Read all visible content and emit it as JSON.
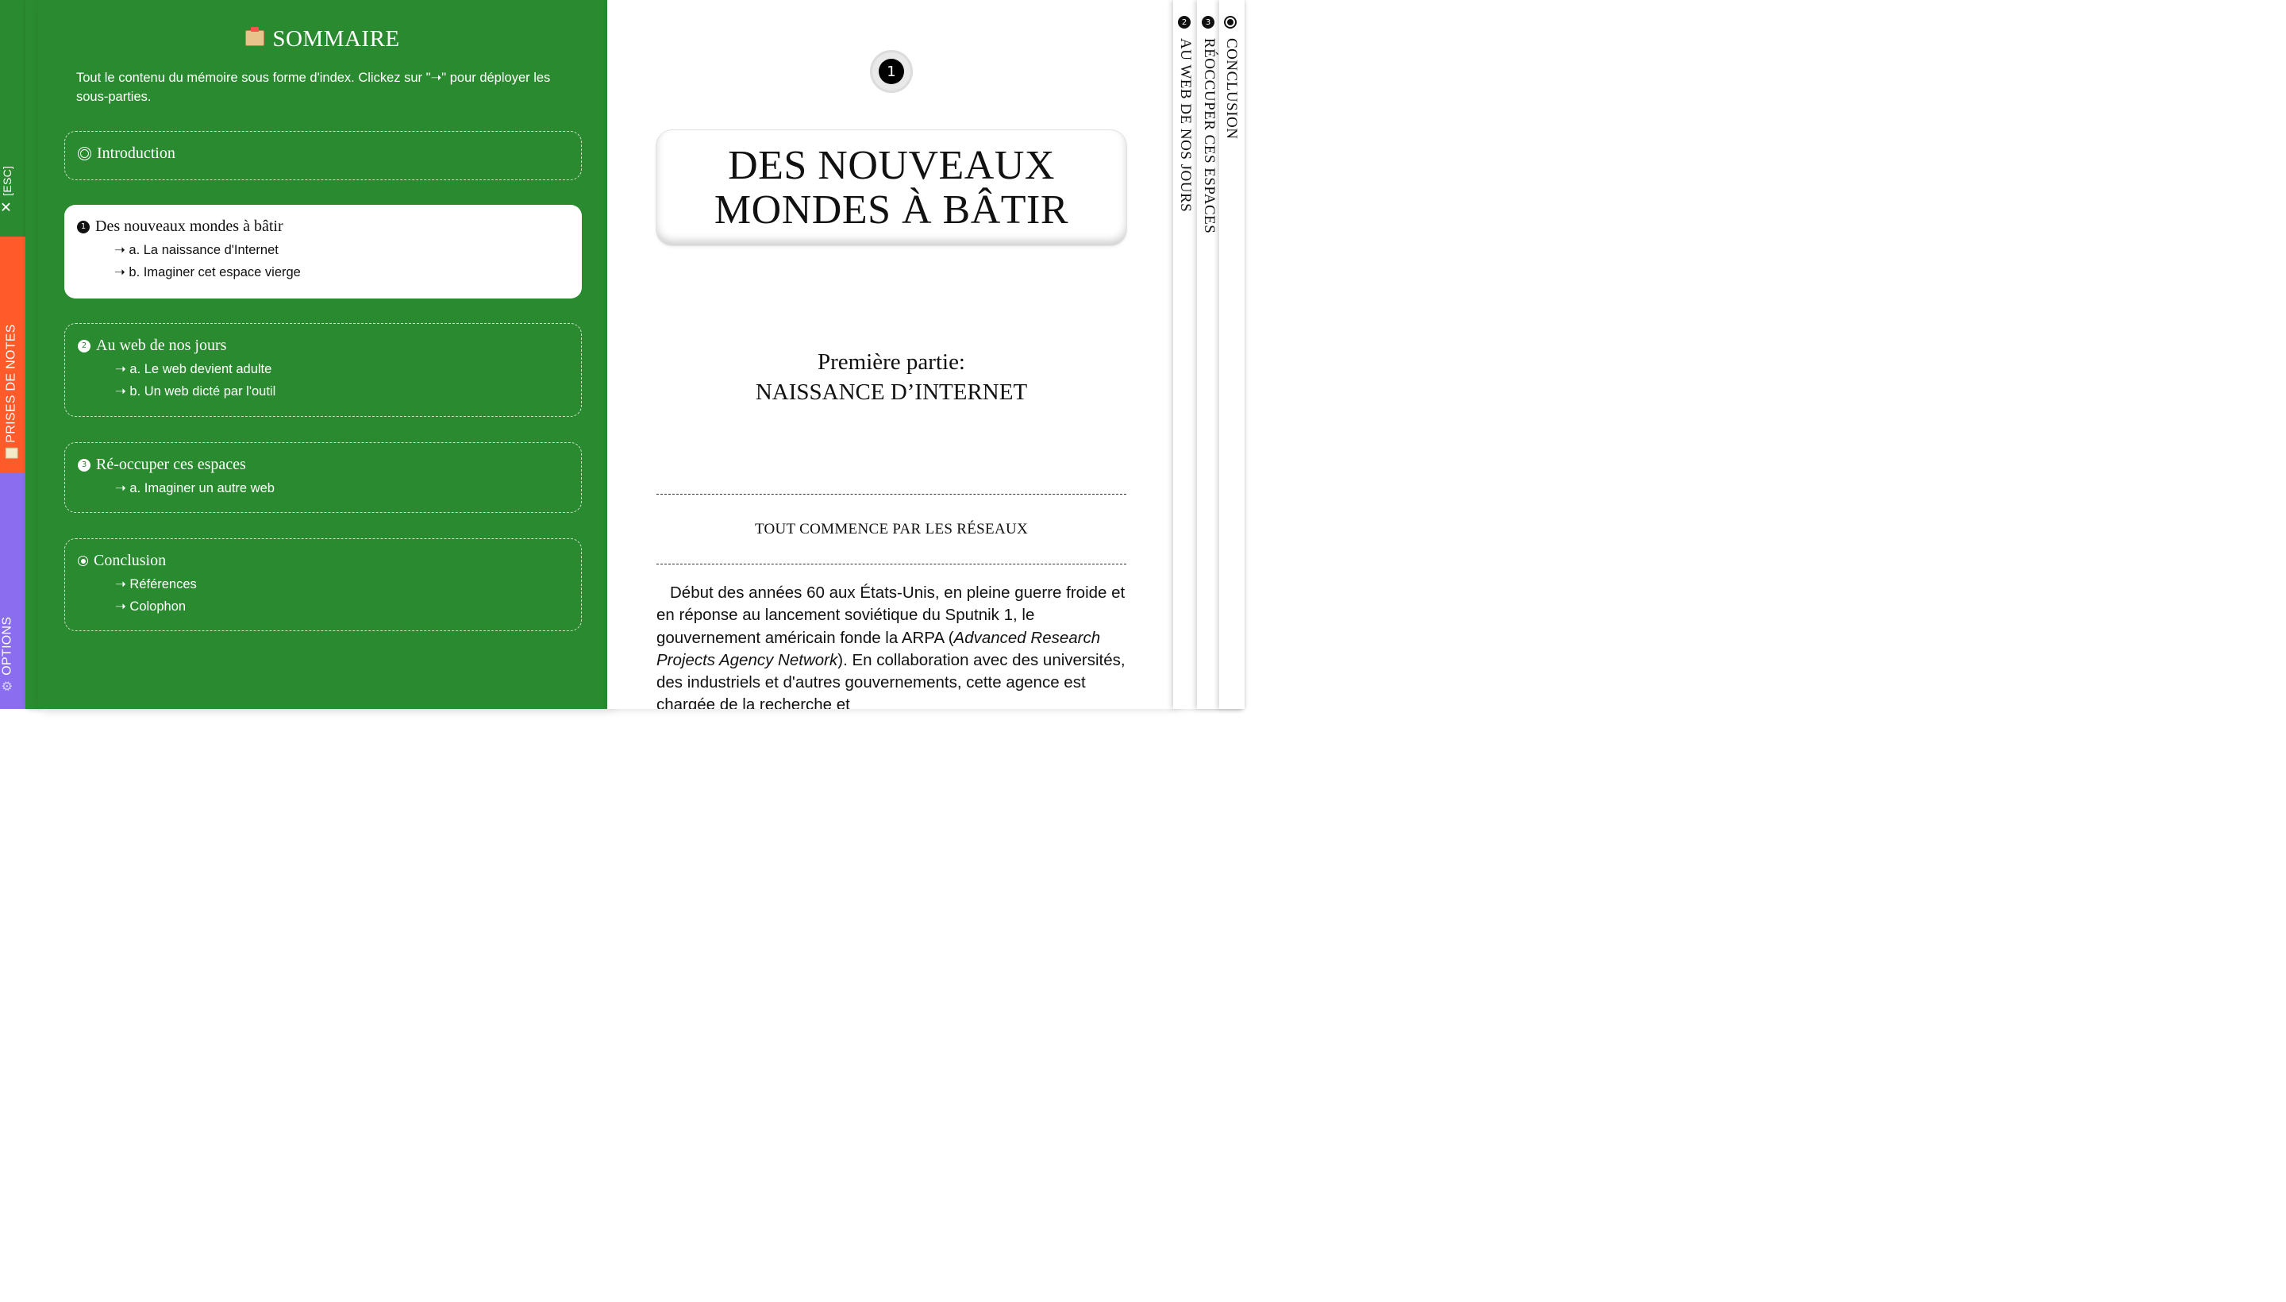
{
  "side_tabs": {
    "esc": {
      "label": "[ESC]",
      "icon": "close-icon"
    },
    "notes": {
      "label": "PRISES DE NOTES",
      "icon": "notepad-icon"
    },
    "options": {
      "label": "OPTIONS",
      "icon": "gear-icon"
    }
  },
  "sommaire": {
    "icon": "card-box-icon",
    "title": "SOMMAIRE",
    "description": "Tout le contenu du mémoire sous forme d'index. Clickez sur \"➝\" pour déployer les sous-parties.",
    "sections": [
      {
        "title": "Introduction",
        "bullet": "ring",
        "subs": []
      },
      {
        "title": "Des nouveaux mondes à bâtir",
        "bullet": "1",
        "active": true,
        "subs": [
          "➝ a. La naissance d'Internet",
          "➝ b. Imaginer cet espace vierge"
        ]
      },
      {
        "title": "Au web de nos jours",
        "bullet": "2",
        "subs": [
          "➝ a. Le web devient adulte",
          "➝ b. Un web dicté par l'outil"
        ]
      },
      {
        "title": "Ré-occuper ces espaces",
        "bullet": "3",
        "subs": [
          "➝ a. Imaginer un autre web"
        ]
      },
      {
        "title": "Conclusion",
        "bullet": "dot",
        "subs": [
          "➝ Références",
          "➝ Colophon"
        ]
      }
    ]
  },
  "page": {
    "badge": "1",
    "title_line1": "DES NOUVEAUX",
    "title_line2": "MONDES À BÂTIR",
    "part_label": "Première partie:",
    "part_title": "NAISSANCE D’INTERNET",
    "section_heading": "TOUT COMMENCE PAR LES RÉSEAUX",
    "body_before_italic": "Début des années 60 aux États-Unis, en pleine guerre froide et en réponse au lancement soviétique du Sputnik 1, le gouvernement américain fonde la ARPA (",
    "body_italic": "Advanced Research Projects Agency Network",
    "body_after_italic": "). En collaboration avec des universités, des industriels et d'autres gouvernements, cette agence est chargée de la recherche et"
  },
  "stack": [
    {
      "num": "2",
      "label": "AU WEB DE NOS JOURS"
    },
    {
      "num": "3",
      "label": "RÉOCCUPER CES ESPACES"
    },
    {
      "num": "",
      "label": "CONCLUSION"
    }
  ],
  "colors": {
    "green": "#2a8a2f",
    "orange": "#ff5a2a",
    "purple": "#8b6df0"
  }
}
